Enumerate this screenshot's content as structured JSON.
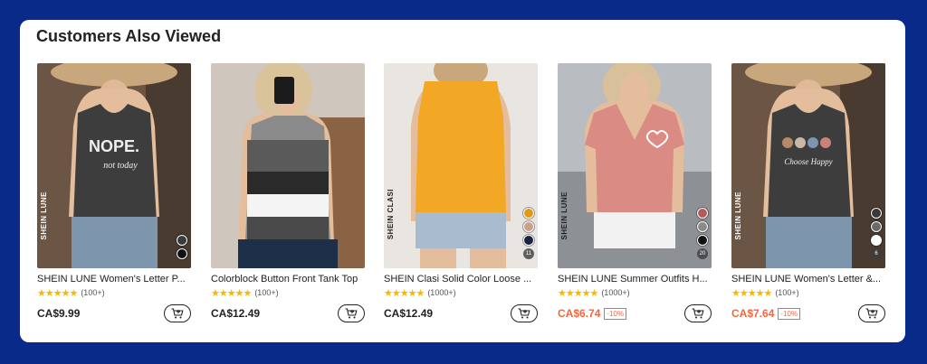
{
  "section": {
    "title": "Customers Also Viewed"
  },
  "products": [
    {
      "name": "SHEIN LUNE Women's Letter P...",
      "reviews": "(100+)",
      "price": "CA$9.99",
      "discount": "",
      "print": "NOPE.",
      "print_sub": "not today",
      "brand": "SHEIN LUNE",
      "swatch_colors": [
        "#3a3a3a",
        "#111111"
      ],
      "more": ""
    },
    {
      "name": "Colorblock Button Front Tank Top",
      "reviews": "(100+)",
      "price": "CA$12.49",
      "discount": "",
      "brand": "",
      "swatch_colors": [],
      "more": ""
    },
    {
      "name": "SHEIN Clasi Solid Color Loose ...",
      "reviews": "(1000+)",
      "price": "CA$12.49",
      "discount": "",
      "brand": "SHEIN CLASI",
      "swatch_colors": [
        "#e39a1b",
        "#c8a08c",
        "#1b2340"
      ],
      "more": "11"
    },
    {
      "name": "SHEIN LUNE Summer Outfits H...",
      "reviews": "(1000+)",
      "price": "CA$6.74",
      "discount": "-10%",
      "brand": "SHEIN LUNE",
      "swatch_colors": [
        "#b45c5c",
        "#8a8a8a",
        "#111111"
      ],
      "more": "20"
    },
    {
      "name": "SHEIN LUNE Women's Letter &...",
      "reviews": "(100+)",
      "price": "CA$7.64",
      "discount": "-10%",
      "print_sub": "Choose Happy",
      "brand": "SHEIN LUNE",
      "swatch_colors": [
        "#3a3a3a",
        "#6a6a6a",
        "#ffffff"
      ],
      "more": "6"
    }
  ],
  "icons": {
    "star": "star-icon",
    "cart": "add-to-cart-icon"
  },
  "colors": {
    "background": "#0a2a8a",
    "sale": "#fa6338",
    "star": "#f6b800"
  }
}
